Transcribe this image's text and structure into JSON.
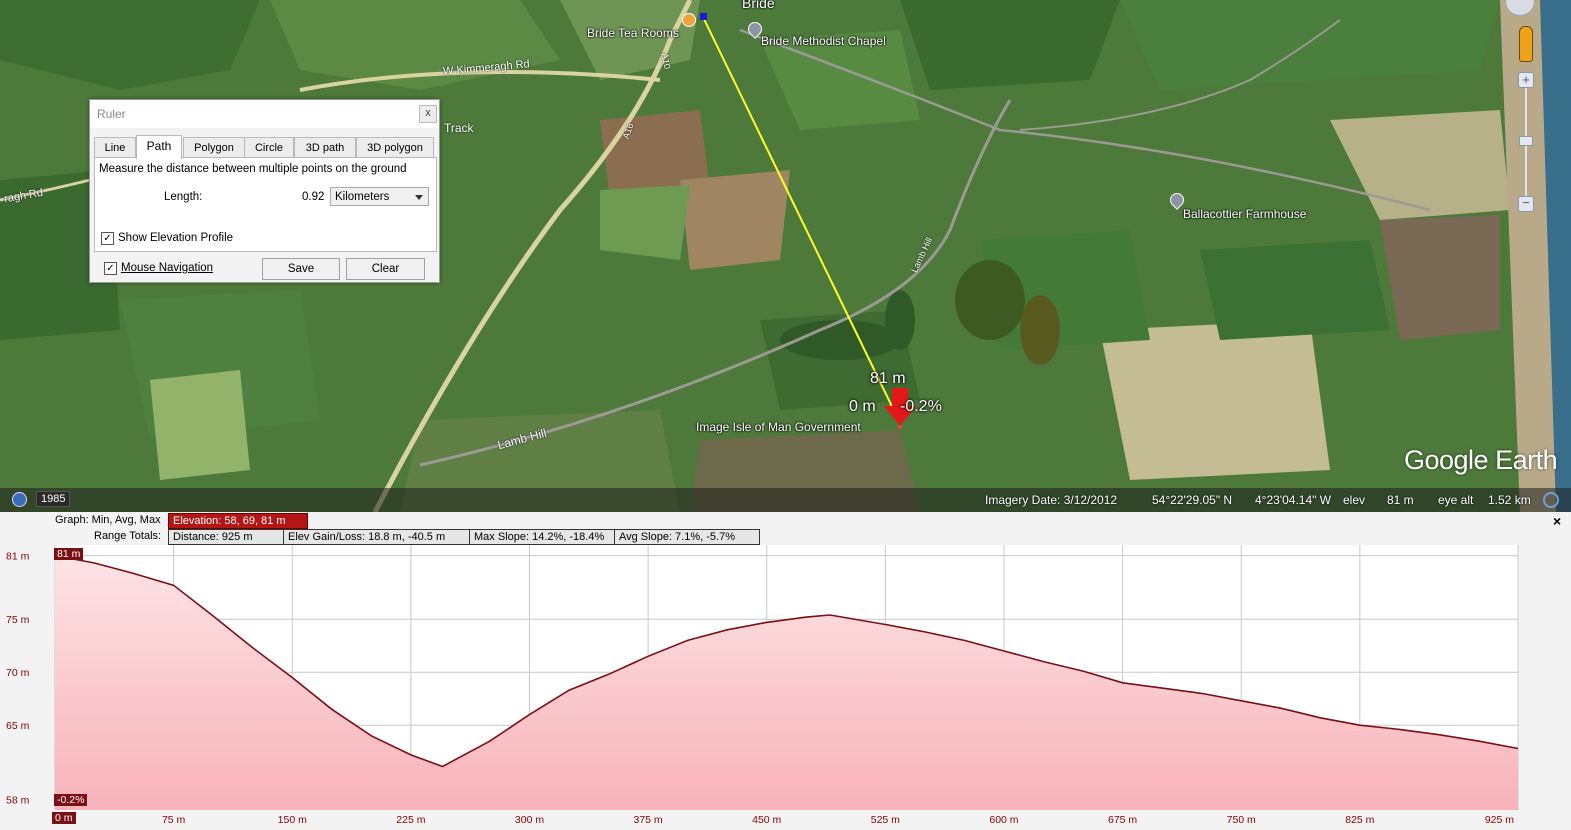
{
  "map": {
    "places": {
      "bride": "Bride",
      "tea_rooms": "Bride Tea Rooms",
      "chapel": "Bride Methodist Chapel",
      "farmhouse": "Ballacottier Farmhouse"
    },
    "roads": {
      "kimmeragh": "W Kimmeragh Rd",
      "track": "Track",
      "ragh": "ragh Rd",
      "a10": "A10",
      "a16": "A16",
      "lamb_hill_1": "Lamb Hill",
      "lamb_hill_2": "Lamb Hill"
    },
    "path_labels": {
      "elevation": "81 m",
      "distance": "0 m",
      "slope": "-0.2%"
    },
    "attribution": "Image Isle of Man Government",
    "logo": "Google Earth",
    "year": "1985",
    "status": {
      "imagery_date": "Imagery Date: 3/12/2012",
      "lat": "54°22'29.05\" N",
      "lon": "4°23'04.14\" W",
      "elev_label": "elev",
      "elev_value": "81 m",
      "eye_label": "eye alt",
      "eye_value": "1.52 km"
    }
  },
  "ruler": {
    "title": "Ruler",
    "close": "x",
    "tabs": [
      "Line",
      "Path",
      "Polygon",
      "Circle",
      "3D path",
      "3D polygon"
    ],
    "active_tab": "Path",
    "description": "Measure the distance between multiple points on the ground",
    "length_label": "Length:",
    "length_value": "0.92",
    "unit": "Kilometers",
    "show_elevation_label": "Show Elevation Profile",
    "show_elevation_checked": true,
    "mouse_nav_label": "Mouse Navigation",
    "mouse_nav_checked": true,
    "save_label": "Save",
    "clear_label": "Clear"
  },
  "profile": {
    "graph_label": "Graph: Min, Avg, Max",
    "elevation": "Elevation: 58, 69, 81 m",
    "range_label": "Range Totals:",
    "distance": "Distance: 925 m",
    "gain_loss": "Elev Gain/Loss: 18.8 m, -40.5 m",
    "max_slope": "Max Slope: 14.2%, -18.4%",
    "avg_slope": "Avg Slope: 7.1%, -5.7%",
    "cursor_elev": "81 m",
    "cursor_slope": "-0.2%",
    "cursor_dist": "0 m",
    "close": "×"
  },
  "chart_data": {
    "type": "area",
    "x": [
      0,
      25,
      50,
      75,
      100,
      125,
      150,
      175,
      200,
      225,
      245,
      275,
      300,
      325,
      350,
      375,
      400,
      425,
      450,
      475,
      490,
      525,
      550,
      575,
      600,
      625,
      650,
      675,
      700,
      725,
      750,
      775,
      800,
      825,
      850,
      875,
      900,
      925
    ],
    "values": [
      81,
      80.3,
      79.3,
      78.2,
      75.3,
      72.3,
      69.5,
      66.5,
      64.0,
      62.2,
      61.1,
      63.5,
      66.0,
      68.3,
      69.8,
      71.5,
      73.0,
      74.0,
      74.7,
      75.2,
      75.4,
      74.5,
      73.8,
      73.0,
      72.0,
      71.0,
      70.1,
      69.0,
      68.5,
      68.0,
      67.3,
      66.6,
      65.7,
      65.0,
      64.6,
      64.1,
      63.5,
      62.8
    ],
    "ytick_values": [
      58,
      65,
      70,
      75,
      81
    ],
    "yticks": [
      "58 m",
      "65 m",
      "70 m",
      "75 m",
      "81 m"
    ],
    "xticks": [
      "0 m",
      "75 m",
      "150 m",
      "225 m",
      "300 m",
      "375 m",
      "450 m",
      "525 m",
      "600 m",
      "675 m",
      "750 m",
      "825 m",
      "925 m"
    ],
    "xtick_values": [
      0,
      75,
      150,
      225,
      300,
      375,
      450,
      525,
      600,
      675,
      750,
      825,
      925
    ],
    "xlim": [
      0,
      925
    ],
    "ylim": [
      57,
      82
    ],
    "grid": true,
    "colors": {
      "line": "#7a0f14",
      "fill_top": "#fde3e5",
      "fill_bottom": "#f7b3b9"
    }
  }
}
